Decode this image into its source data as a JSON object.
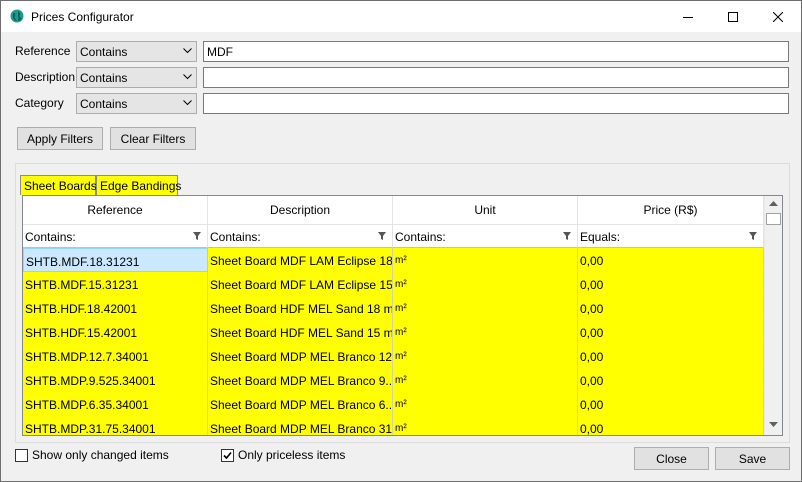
{
  "window": {
    "title": "Prices Configurator"
  },
  "filters": {
    "reference": {
      "label": "Reference",
      "mode": "Contains",
      "value": "MDF"
    },
    "description": {
      "label": "Description",
      "mode": "Contains",
      "value": ""
    },
    "category": {
      "label": "Category",
      "mode": "Contains",
      "value": ""
    }
  },
  "buttons": {
    "apply": "Apply Filters",
    "clear": "Clear Filters",
    "close": "Close",
    "save": "Save"
  },
  "tabs": [
    {
      "label": "Sheet Boards",
      "active": true
    },
    {
      "label": "Edge Bandings",
      "active": false
    }
  ],
  "grid": {
    "columns": [
      "Reference",
      "Description",
      "Unit",
      "Price (R$)"
    ],
    "filter_row": [
      "Contains:",
      "Contains:",
      "Contains:",
      "Equals:"
    ],
    "rows": [
      [
        "SHTB.MDF.18.31231",
        "Sheet Board MDF LAM Eclipse 18...",
        "m²",
        "0,00"
      ],
      [
        "SHTB.MDF.15.31231",
        "Sheet Board MDF LAM Eclipse 15...",
        "m²",
        "0,00"
      ],
      [
        "SHTB.HDF.18.42001",
        "Sheet Board HDF MEL Sand 18 m...",
        "m²",
        "0,00"
      ],
      [
        "SHTB.HDF.15.42001",
        "Sheet Board HDF MEL Sand 15 m...",
        "m²",
        "0,00"
      ],
      [
        "SHTB.MDP.12.7.34001",
        "Sheet Board MDP MEL Branco 12...",
        "m²",
        "0,00"
      ],
      [
        "SHTB.MDP.9.525.34001",
        "Sheet Board MDP MEL Branco 9....",
        "m²",
        "0,00"
      ],
      [
        "SHTB.MDP.6.35.34001",
        "Sheet Board MDP MEL Branco 6....",
        "m²",
        "0,00"
      ],
      [
        "SHTB.MDP.31.75.34001",
        "Sheet Board MDP MEL Branco 31...",
        "m²",
        "0,00"
      ]
    ],
    "selected_row": 0
  },
  "options": {
    "show_changed": {
      "label": "Show only changed items",
      "checked": false
    },
    "only_priceless": {
      "label": "Only priceless items",
      "checked": true
    }
  },
  "colors": {
    "highlight": "#ffff00",
    "selection": "#cce8ff",
    "accent": "#0078d7"
  },
  "icons": {
    "app": "globe-icon",
    "minimize": "minimize-icon",
    "maximize": "maximize-icon",
    "close": "close-icon",
    "filter": "funnel-icon",
    "dropdown": "chevron-down-icon"
  }
}
